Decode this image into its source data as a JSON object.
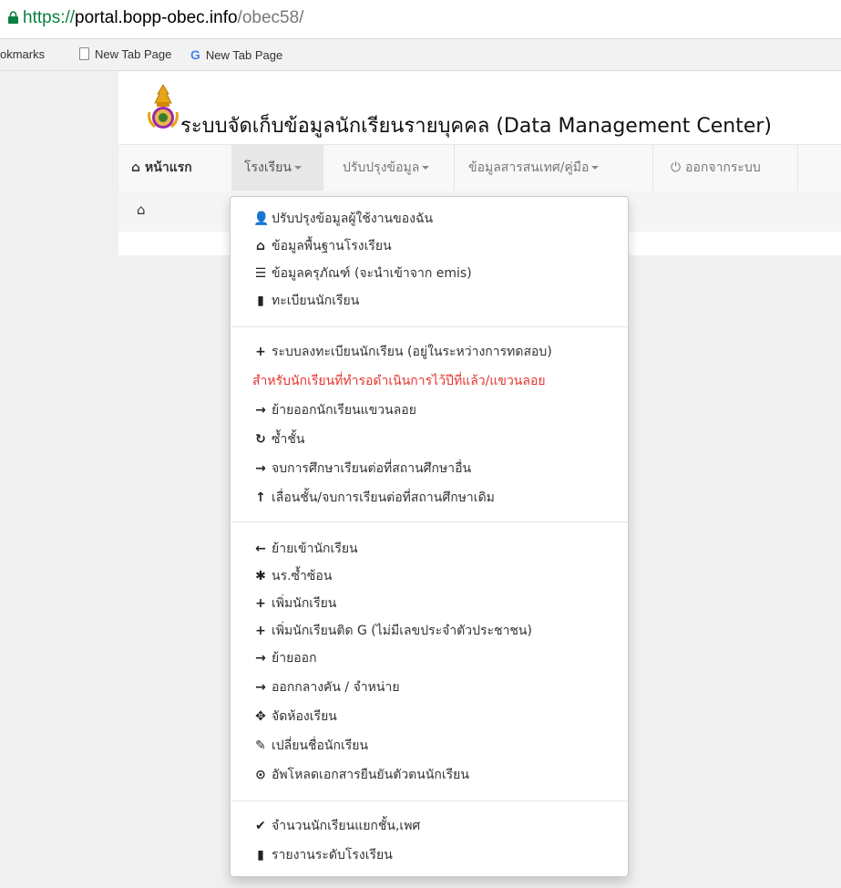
{
  "browser": {
    "url_secure": "https://",
    "url_host": "portal.bopp-obec.info",
    "url_path": "/obec58/",
    "bookmarks": [
      {
        "label": "okmarks",
        "icon": "none"
      },
      {
        "label": "New Tab Page",
        "icon": "page-icon"
      },
      {
        "label": "New Tab Page",
        "icon": "google-icon"
      }
    ]
  },
  "header": {
    "title": "ระบบจัดเก็บข้อมูลนักเรียนรายบุคคล (Data Management Center)"
  },
  "navbar": {
    "home": "หน้าแรก",
    "school": "โรงเรียน",
    "update": "ปรับปรุงข้อมูล",
    "info": "ข้อมูลสารสนเทศ/คู่มือ",
    "logout": "ออกจากระบบ"
  },
  "menu": {
    "group1": [
      {
        "icon": "user-icon",
        "glyph": "👤",
        "label": "ปรับปรุงข้อมูลผู้ใช้งานของฉัน"
      },
      {
        "icon": "home-icon",
        "glyph": "⌂",
        "label": "ข้อมูลพื้นฐานโรงเรียน"
      },
      {
        "icon": "list-icon",
        "glyph": "☰",
        "label": "ข้อมูลครุภัณฑ์ (จะนำเข้าจาก emis)"
      },
      {
        "icon": "book-icon",
        "glyph": "▮",
        "label": "ทะเบียนนักเรียน"
      }
    ],
    "group2": [
      {
        "icon": "plus-icon",
        "glyph": "+",
        "label": "ระบบลงทะเบียนนักเรียน (อยู่ในระหว่างการทดสอบ)"
      },
      {
        "icon": "",
        "glyph": "",
        "label": "สำหรับนักเรียนที่ทำรอดำเนินการไว้ปีที่แล้ว/แขวนลอย",
        "alert": true
      },
      {
        "icon": "arrow-right-icon",
        "glyph": "→",
        "label": "ย้ายออกนักเรียนแขวนลอย"
      },
      {
        "icon": "repeat-icon",
        "glyph": "↻",
        "label": "ซ้ำชั้น"
      },
      {
        "icon": "arrow-right-icon",
        "glyph": "→",
        "label": "จบการศึกษาเรียนต่อที่สถานศึกษาอื่น"
      },
      {
        "icon": "arrow-up-icon",
        "glyph": "↑",
        "label": "เลื่อนชั้น/จบการเรียนต่อที่สถานศึกษาเดิม"
      }
    ],
    "group3": [
      {
        "icon": "arrow-left-icon",
        "glyph": "←",
        "label": "ย้ายเข้านักเรียน"
      },
      {
        "icon": "asterisk-icon",
        "glyph": "✱",
        "label": "นร.ซ้ำซ้อน"
      },
      {
        "icon": "plus-icon",
        "glyph": "+",
        "label": "เพิ่มนักเรียน"
      },
      {
        "icon": "plus-icon",
        "glyph": "+",
        "label": "เพิ่มนักเรียนติด G (ไม่มีเลขประจำตัวประชาชน)"
      },
      {
        "icon": "arrow-right-icon",
        "glyph": "→",
        "label": "ย้ายออก"
      },
      {
        "icon": "arrow-right-icon",
        "glyph": "→",
        "label": "ออกกลางคัน / จำหน่าย"
      },
      {
        "icon": "move-icon",
        "glyph": "✥",
        "label": "จัดห้องเรียน"
      },
      {
        "icon": "pencil-icon",
        "glyph": "✎",
        "label": "เปลี่ยนชื่อนักเรียน"
      },
      {
        "icon": "upload-icon",
        "glyph": "⊙",
        "label": "อัพโหลดเอกสารยืนยันตัวตนนักเรียน"
      }
    ],
    "group4": [
      {
        "icon": "check-icon",
        "glyph": "✔",
        "label": "จำนวนนักเรียนแยกชั้น,เพศ"
      },
      {
        "icon": "file-icon",
        "glyph": "▮",
        "label": "รายงานระดับโรงเรียน"
      }
    ]
  },
  "colors": {
    "alert_text": "#e3342f",
    "secure_green": "#0b8043",
    "navbar_bg": "#f8f8f8"
  }
}
